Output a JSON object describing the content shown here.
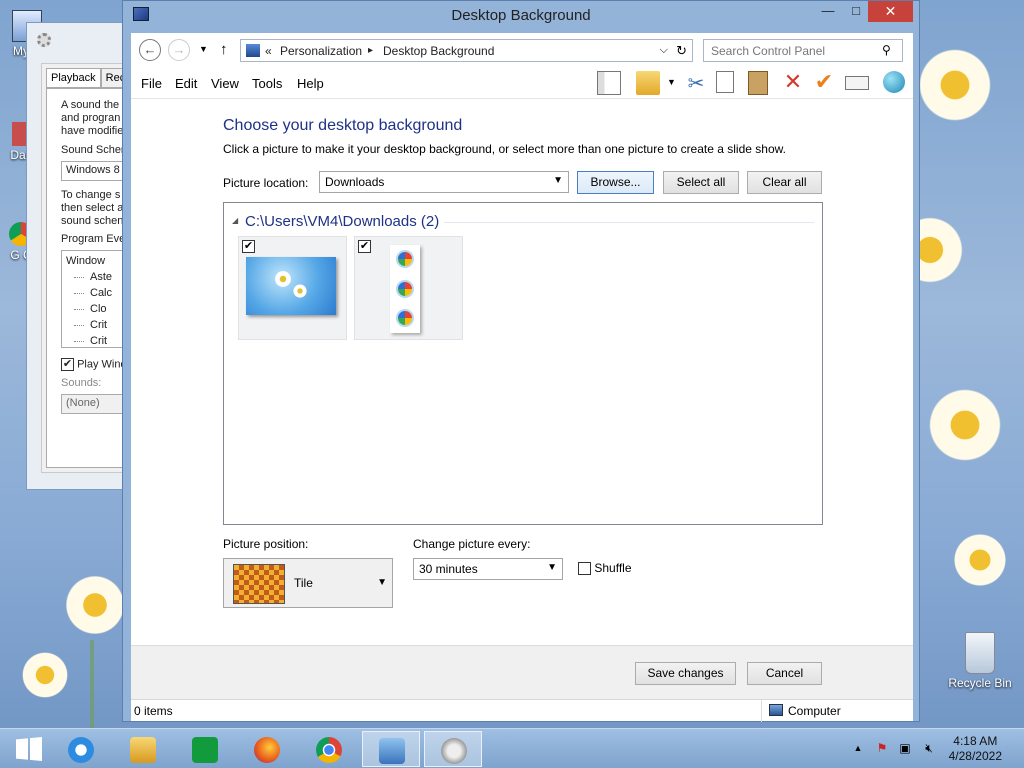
{
  "desktop": {
    "icons": [
      {
        "label": "My C"
      },
      {
        "label": "Data"
      },
      {
        "label": "G C"
      },
      {
        "label": "Recycle Bin"
      }
    ]
  },
  "sound_dialog": {
    "tabs": [
      "Playback",
      "Reco"
    ],
    "intro_lines": [
      "A sound the",
      "and progran",
      "have modifie"
    ],
    "scheme_label": "Sound Schen",
    "scheme_value": "Windows 8",
    "change_lines": [
      "To change s",
      "then select a",
      "sound schen"
    ],
    "events_label": "Program Eve",
    "tree_root": "Window",
    "tree_items": [
      "Aste",
      "Calc",
      "Clo",
      "Crit",
      "Crit"
    ],
    "play_label": "Play Wind",
    "sounds_label": "Sounds:",
    "sounds_value": "(None)"
  },
  "window": {
    "title": "Desktop Background",
    "minimize": "—",
    "maximize": "□",
    "close": "✕",
    "breadcrumb": {
      "prefix": "«",
      "path1": "Personalization",
      "separator": "▸",
      "path2": "Desktop Background"
    },
    "search_placeholder": "Search Control Panel",
    "menu": [
      "File",
      "Edit",
      "View",
      "Tools",
      "Help"
    ],
    "heading": "Choose your desktop background",
    "description": "Click a picture to make it your desktop background, or select more than one picture to create a slide show.",
    "picture_location_label": "Picture location:",
    "picture_location_value": "Downloads",
    "browse_label": "Browse...",
    "select_all_label": "Select all",
    "clear_all_label": "Clear all",
    "group_header": "C:\\Users\\VM4\\Downloads (2)",
    "group_toggle": "◢",
    "thumbnails": [
      {
        "checked": "✔"
      },
      {
        "checked": "✔"
      }
    ],
    "picture_position_label": "Picture position:",
    "picture_position_value": "Tile",
    "change_every_label": "Change picture every:",
    "change_every_value": "30 minutes",
    "shuffle_label": "Shuffle",
    "save_label": "Save changes",
    "cancel_label": "Cancel",
    "status_items": "0 items",
    "status_location": "Computer"
  },
  "taskbar": {
    "time": "4:18 AM",
    "date": "4/28/2022",
    "apps": [
      "start",
      "internet-explorer",
      "file-explorer",
      "store",
      "firefox",
      "chrome",
      "control-panel",
      "sound"
    ]
  }
}
